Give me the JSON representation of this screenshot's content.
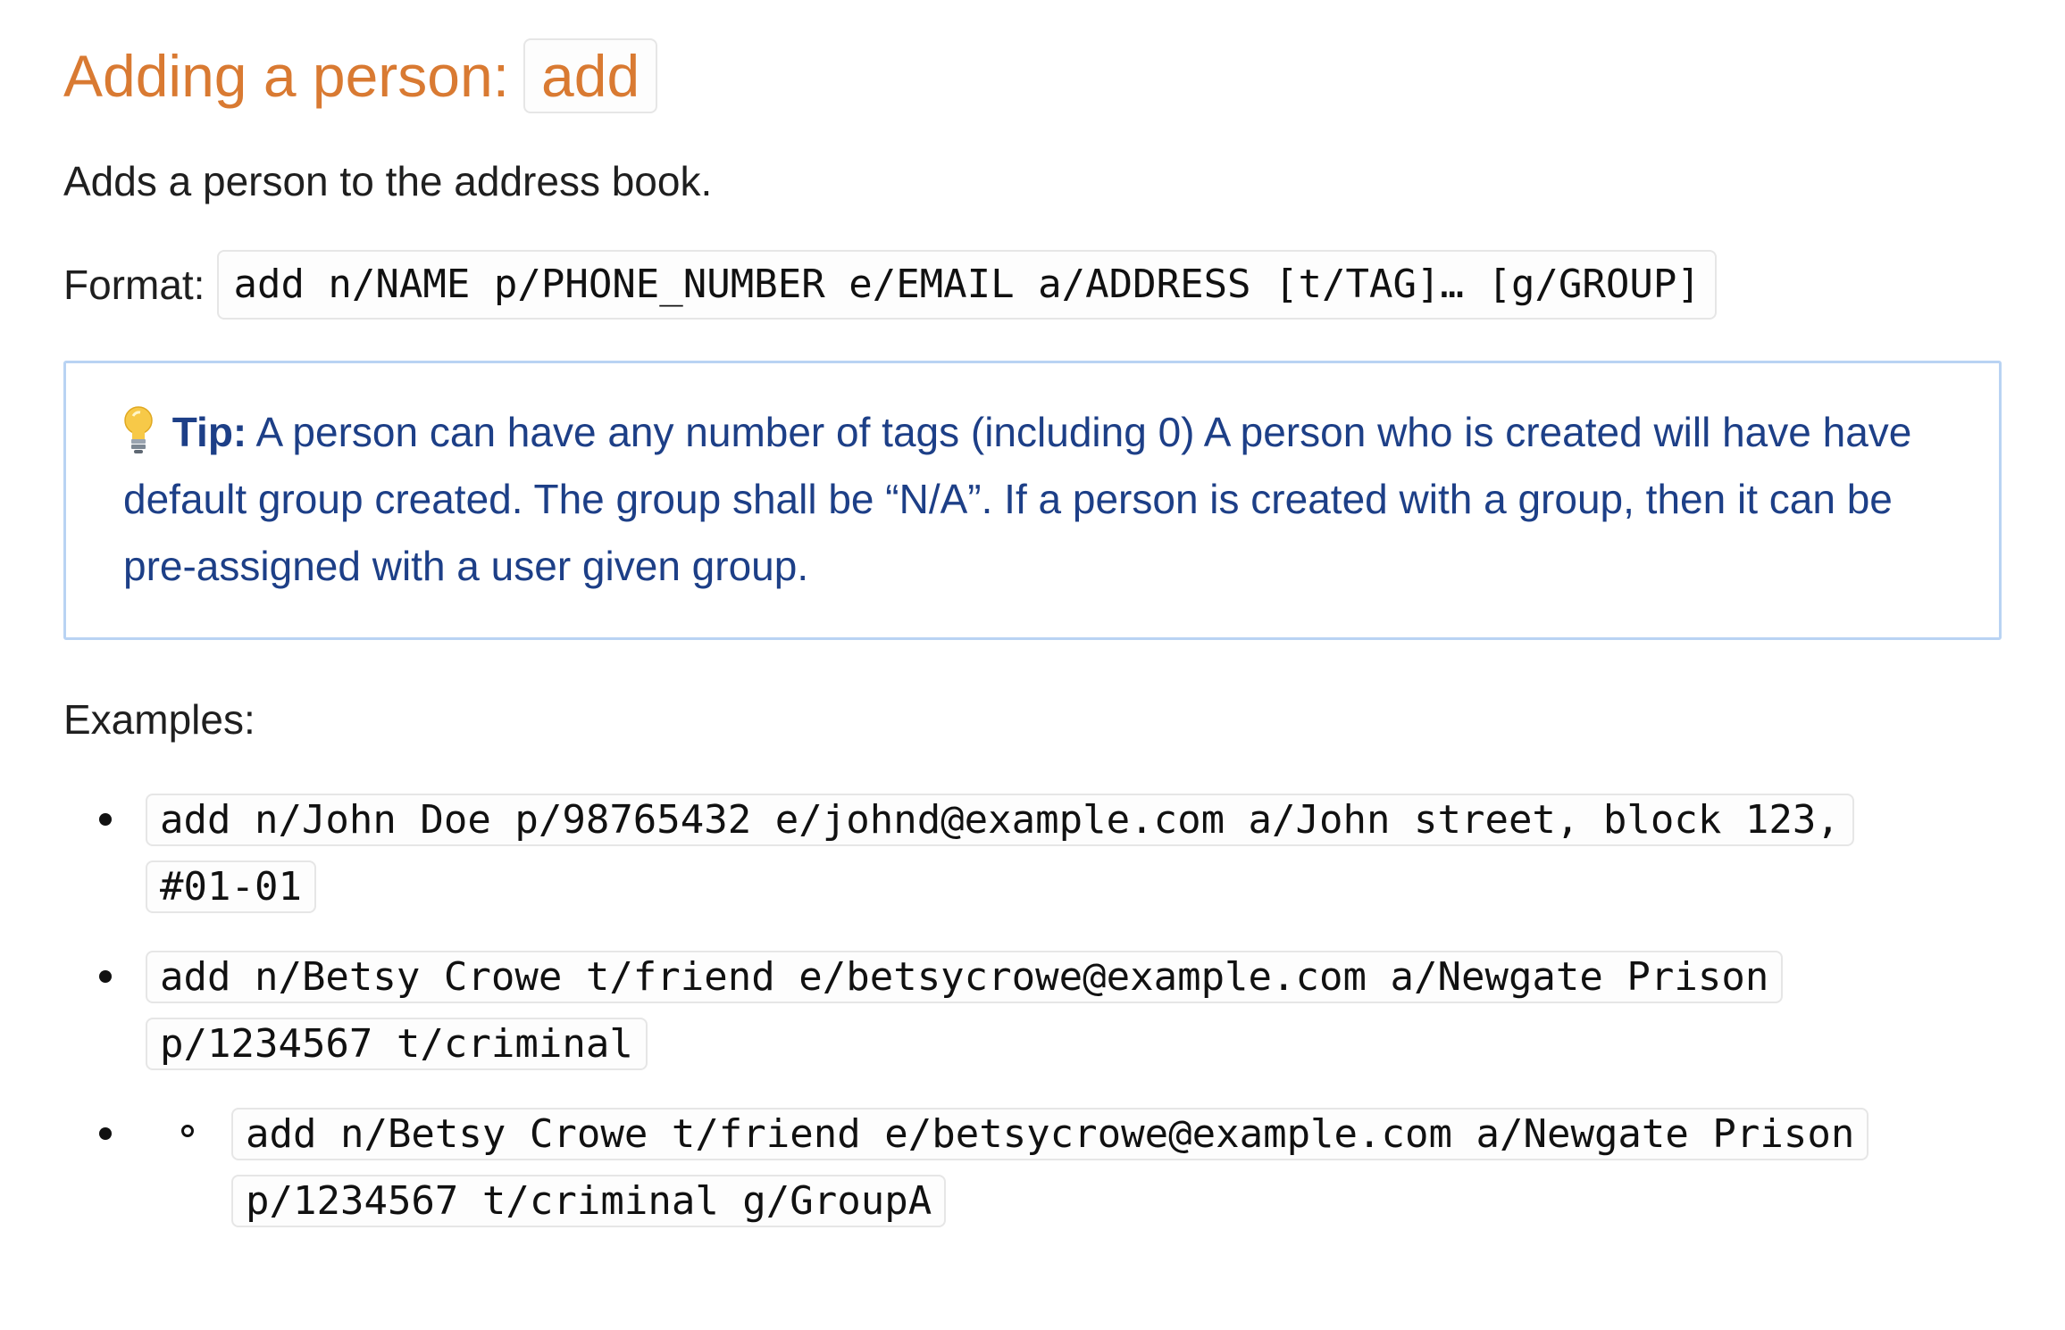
{
  "section": {
    "title_text": "Adding a person:",
    "title_command": "add",
    "description": "Adds a person to the address book.",
    "format_label": "Format:",
    "format_code": "add n/NAME p/PHONE_NUMBER e/EMAIL a/ADDRESS [t/TAG]… [g/GROUP]"
  },
  "tip": {
    "icon": "lightbulb-icon",
    "label": "Tip:",
    "text": "A person can have any number of tags (including 0) A person who is created will have have default group created. The group shall be “N/A”. If a person is created with a group, then it can be pre-assigned with a user given group."
  },
  "examples": {
    "label": "Examples:",
    "items": [
      {
        "code": "add n/John Doe p/98765432 e/johnd@example.com a/John street, block 123, #01-01"
      },
      {
        "code": "add n/Betsy Crowe t/friend e/betsycrowe@example.com a/Newgate Prison p/1234567 t/criminal"
      }
    ],
    "nested_item": {
      "code": "add n/Betsy Crowe t/friend e/betsycrowe@example.com a/Newgate Prison p/1234567 t/criminal g/GroupA"
    }
  },
  "colors": {
    "heading": "#d97a32",
    "tip_text": "#1d3f87",
    "tip_border": "#b9d3f3",
    "code_border": "#e6e6e6"
  }
}
